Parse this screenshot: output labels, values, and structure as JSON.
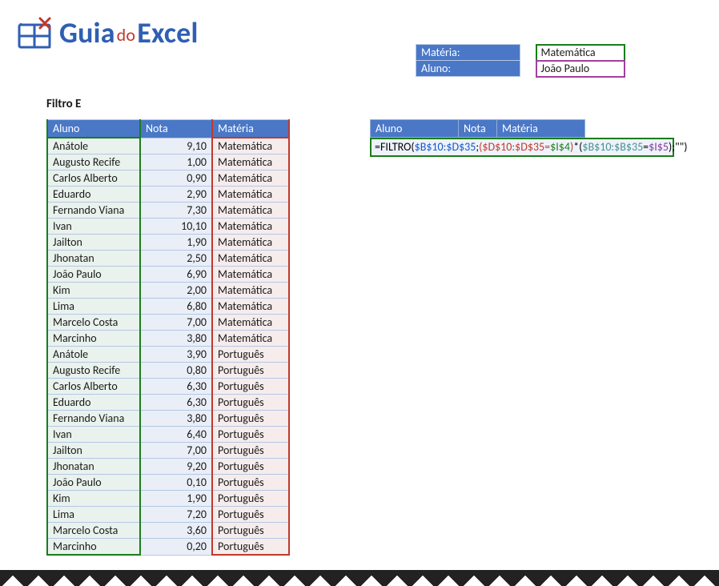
{
  "brand": {
    "guia": "Guia",
    "do": "do",
    "excel": "Excel"
  },
  "criteria": {
    "materia_label": "Matéria:",
    "aluno_label": "Aluno:",
    "materia_value": "Matemática",
    "aluno_value": "João Paulo"
  },
  "section_title": "Filtro E",
  "table": {
    "headers": {
      "aluno": "Aluno",
      "nota": "Nota",
      "materia": "Matéria"
    },
    "rows": [
      {
        "aluno": "Anátole",
        "nota": "9,10",
        "materia": "Matemática"
      },
      {
        "aluno": "Augusto Recife",
        "nota": "1,00",
        "materia": "Matemática"
      },
      {
        "aluno": "Carlos Alberto",
        "nota": "0,90",
        "materia": "Matemática"
      },
      {
        "aluno": "Eduardo",
        "nota": "2,90",
        "materia": "Matemática"
      },
      {
        "aluno": "Fernando Viana",
        "nota": "7,30",
        "materia": "Matemática"
      },
      {
        "aluno": "Ivan",
        "nota": "10,10",
        "materia": "Matemática"
      },
      {
        "aluno": "Jailton",
        "nota": "1,90",
        "materia": "Matemática"
      },
      {
        "aluno": "Jhonatan",
        "nota": "2,50",
        "materia": "Matemática"
      },
      {
        "aluno": "João Paulo",
        "nota": "6,90",
        "materia": "Matemática"
      },
      {
        "aluno": "Kim",
        "nota": "2,00",
        "materia": "Matemática"
      },
      {
        "aluno": "Lima",
        "nota": "6,80",
        "materia": "Matemática"
      },
      {
        "aluno": "Marcelo Costa",
        "nota": "7,00",
        "materia": "Matemática"
      },
      {
        "aluno": "Marcinho",
        "nota": "3,80",
        "materia": "Matemática"
      },
      {
        "aluno": "Anátole",
        "nota": "3,90",
        "materia": "Português"
      },
      {
        "aluno": "Augusto Recife",
        "nota": "0,80",
        "materia": "Português"
      },
      {
        "aluno": "Carlos Alberto",
        "nota": "6,30",
        "materia": "Português"
      },
      {
        "aluno": "Eduardo",
        "nota": "6,30",
        "materia": "Português"
      },
      {
        "aluno": "Fernando Viana",
        "nota": "3,80",
        "materia": "Português"
      },
      {
        "aluno": "Ivan",
        "nota": "6,40",
        "materia": "Português"
      },
      {
        "aluno": "Jailton",
        "nota": "7,00",
        "materia": "Português"
      },
      {
        "aluno": "Jhonatan",
        "nota": "9,20",
        "materia": "Português"
      },
      {
        "aluno": "João Paulo",
        "nota": "0,10",
        "materia": "Português"
      },
      {
        "aluno": "Kim",
        "nota": "1,90",
        "materia": "Português"
      },
      {
        "aluno": "Lima",
        "nota": "7,20",
        "materia": "Português"
      },
      {
        "aluno": "Marcelo Costa",
        "nota": "3,60",
        "materia": "Português"
      },
      {
        "aluno": "Marcinho",
        "nota": "0,20",
        "materia": "Português"
      }
    ]
  },
  "result": {
    "headers": {
      "aluno": "Aluno",
      "nota": "Nota",
      "materia": "Matéria"
    }
  },
  "formula": {
    "raw": "=FILTRO($B$10:$D$35;($D$10:$D$35=$I$4)*($B$10:$B$35=$I$5);\"\")",
    "eq": "=",
    "fn": "FILTRO",
    "open": "(",
    "r1": "$B$10:$D$35",
    "semi1": ";",
    "p_open1": "(",
    "r2": "$D$10:$D$35",
    "eq1": "=",
    "r3": "$I$4",
    "p_close1": ")",
    "mult": "*",
    "p_open2": "(",
    "r4": "$B$10:$B$35",
    "eq2": "=",
    "r5": "$I$5",
    "p_close2": ")",
    "semi2": ";",
    "empty": "\"\"",
    "close": ")"
  }
}
